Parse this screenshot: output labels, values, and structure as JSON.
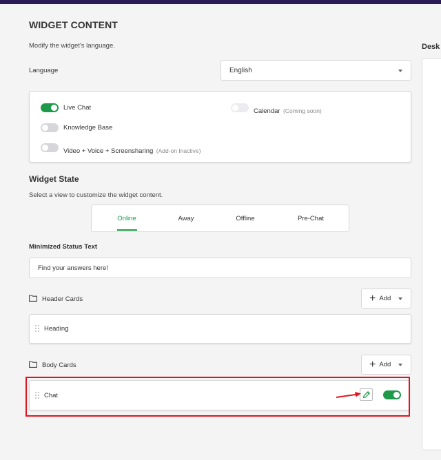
{
  "widget_content": {
    "title": "WIDGET CONTENT",
    "subtitle": "Modify the widget's language.",
    "language_label": "Language",
    "language_value": "English"
  },
  "channels": {
    "live_chat": {
      "label": "Live Chat",
      "enabled": true
    },
    "calendar": {
      "label": "Calendar",
      "note": "(Coming soon)",
      "enabled": false
    },
    "knowledge_base": {
      "label": "Knowledge Base",
      "enabled": false
    },
    "video": {
      "label": "Video + Voice + Screensharing",
      "note": "(Add-on Inactive)",
      "enabled": false
    }
  },
  "widget_state": {
    "title": "Widget State",
    "subtitle": "Select a view to customize the widget content.",
    "tabs": [
      {
        "label": "Online",
        "active": true
      },
      {
        "label": "Away",
        "active": false
      },
      {
        "label": "Offline",
        "active": false
      },
      {
        "label": "Pre-Chat",
        "active": false
      }
    ]
  },
  "minimized": {
    "label": "Minimized Status Text",
    "value": "Find your answers here!"
  },
  "header_cards": {
    "label": "Header Cards",
    "add_label": "Add",
    "items": [
      {
        "label": "Heading"
      }
    ]
  },
  "body_cards": {
    "label": "Body Cards",
    "add_label": "Add",
    "items": [
      {
        "label": "Chat",
        "enabled": true
      }
    ]
  },
  "right_panel": {
    "title": "Desk"
  },
  "colors": {
    "accent": "#1e9a4a",
    "highlight": "#e0141e",
    "top_bar": "#2a1a55"
  }
}
